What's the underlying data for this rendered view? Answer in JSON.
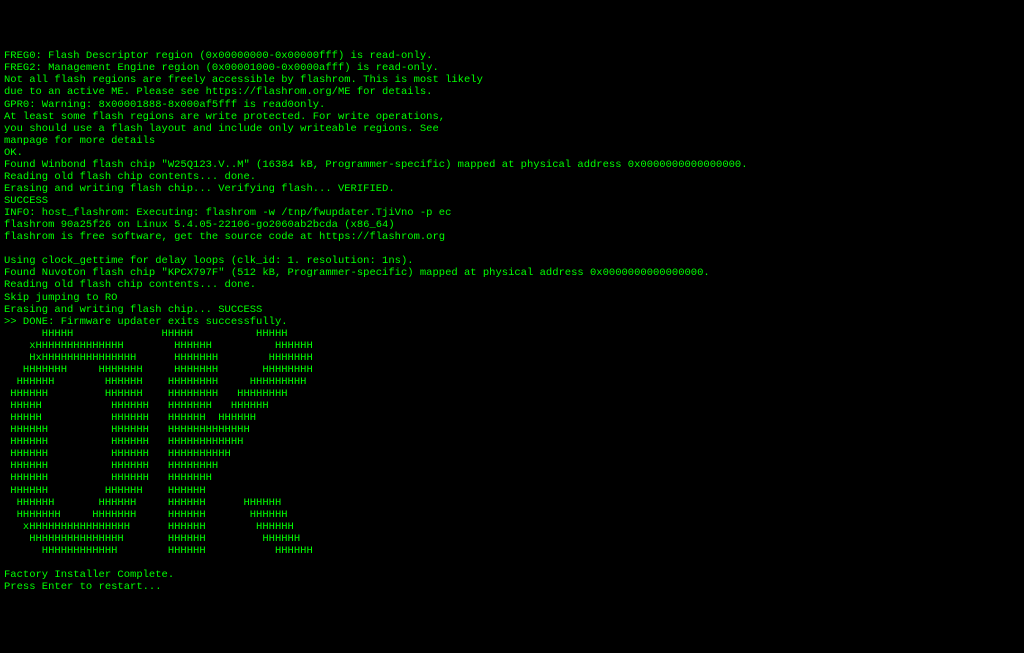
{
  "terminal": {
    "colors": {
      "background": "#000000",
      "foreground": "#00ff00"
    },
    "lines": [
      "FREG0: Flash Descriptor region (0x00000000-0x00000fff) is read-only.",
      "FREG2: Management Engine region (0x00001000-0x0000afff) is read-only.",
      "Not all flash regions are freely accessible by flashrom. This is most likely",
      "due to an active ME. Please see https://flashrom.org/ME for details.",
      "GPR0: Warning: 8x00001888-8x000af5fff is read0only.",
      "At least some flash regions are write protected. For write operations,",
      "you should use a flash layout and include only writeable regions. See",
      "manpage for more details",
      "OK.",
      "Found Winbond flash chip \"W25Q123.V..M\" (16384 kB, Programmer-specific) mapped at physical address 0x0000000000000000.",
      "Reading old flash chip contents... done.",
      "Erasing and writing flash chip... Verifying flash... VERIFIED.",
      "SUCCESS",
      "INFO: host_flashrom: Executing: flashrom -w /tnp/fwupdater.TjiVno -p ec",
      "flashrom 90a25f26 on Linux 5.4.05-22106-go2060ab2bcda (x86_64)",
      "flashrom is free software, get the source code at https://flashrom.org",
      "",
      "Using clock_gettime for delay loops (clk_id: 1. resolution: 1ns).",
      "Found Nuvoton flash chip \"KPCX797F\" (512 kB, Programmer-specific) mapped at physical address 0x0000000000000000.",
      "Reading old flash chip contents... done.",
      "Skip jumping to RO",
      "Erasing and writing flash chip... SUCCESS",
      ">> DONE: Firmware updater exits successfully.",
      "      HHHHH              HHHHH          HHHHH",
      "    xHHHHHHHHHHHHHH        HHHHHH          HHHHHH",
      "    HxHHHHHHHHHHHHHHH      HHHHHHH        HHHHHHH",
      "   HHHHHHH     HHHHHHH     HHHHHHH       HHHHHHHH",
      "  HHHHHH        HHHHHH    HHHHHHHH     HHHHHHHHH",
      " HHHHHH         HHHHHH    HHHHHHHH   HHHHHHHH",
      " HHHHH           HHHHHH   HHHHHHH   HHHHHH",
      " HHHHH           HHHHHH   HHHHHH  HHHHHH",
      " HHHHHH          HHHHHH   HHHHHHHHHHHHH",
      " HHHHHH          HHHHHH   HHHHHHHHHHHH",
      " HHHHHH          HHHHHH   HHHHHHHHHH",
      " HHHHHH          HHHHHH   HHHHHHHH",
      " HHHHHH          HHHHHH   HHHHHHH",
      " HHHHHH         HHHHHH    HHHHHH",
      "  HHHHHH       HHHHHH     HHHHHH      HHHHHH",
      "  HHHHHHH     HHHHHHH     HHHHHH       HHHHHH",
      "   xHHHHHHHHHHHHHHHH      HHHHHH        HHHHHH",
      "    HHHHHHHHHHHHHHH       HHHHHH         HHHHHH",
      "      HHHHHHHHHHHH        HHHHHH           HHHHHH",
      "",
      "Factory Installer Complete.",
      "Press Enter to restart..."
    ]
  }
}
